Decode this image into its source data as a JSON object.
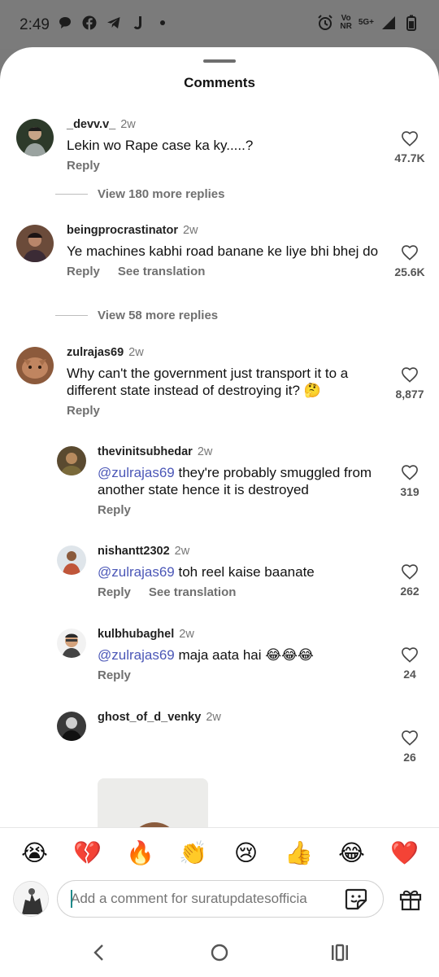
{
  "status_bar": {
    "time": "2:49",
    "net_top": "Vo",
    "net_bottom": "NR",
    "signal_label": "5G+",
    "icons": [
      "chat-bubble-icon",
      "facebook-icon",
      "telegram-icon",
      "j-app-icon",
      "dot-icon",
      "alarm-icon",
      "volte-icon",
      "5g-icon",
      "signal-icon",
      "battery-icon"
    ]
  },
  "sheet": {
    "title": "Comments"
  },
  "comments": [
    {
      "user": "_devv.v_",
      "time": "2w",
      "text": "Lekin wo Rape case ka ky.....?",
      "likes": "47.7K",
      "reply": "Reply",
      "more_replies": "View 180 more replies"
    },
    {
      "user": "beingprocrastinator",
      "time": "2w",
      "text": "Ye machines kabhi road banane ke liye bhi bhej do",
      "likes": "25.6K",
      "reply": "Reply",
      "translate": "See translation",
      "more_replies": "View 58 more replies"
    },
    {
      "user": "zulrajas69",
      "time": "2w",
      "text": "Why can't the government just transport it to a different state instead of destroying it? 🤔",
      "likes": "8,877",
      "reply": "Reply"
    }
  ],
  "replies": [
    {
      "user": "thevinitsubhedar",
      "time": "2w",
      "mention": "@zulrajas69",
      "text": " they're probably smuggled from another state hence it is destroyed",
      "likes": "319",
      "reply": "Reply"
    },
    {
      "user": "nishantt2302",
      "time": "2w",
      "mention": "@zulrajas69",
      "text": " toh reel kaise baanate",
      "likes": "262",
      "reply": "Reply",
      "translate": "See translation"
    },
    {
      "user": "kulbhubaghel",
      "time": "2w",
      "mention": "@zulrajas69",
      "text": " maja aata hai 😂😂😂",
      "likes": "24",
      "reply": "Reply"
    },
    {
      "user": "ghost_of_d_venky",
      "time": "2w",
      "likes": "26"
    }
  ],
  "emoji_bar": [
    "😭",
    "💔",
    "🔥",
    "👏",
    "😢",
    "👍",
    "😂",
    "❤️"
  ],
  "input": {
    "placeholder": "Add a comment for suratupdatesofficia"
  },
  "colors": {
    "mention": "#4b57b7",
    "muted": "#707070",
    "heart_red": "#e02020"
  }
}
